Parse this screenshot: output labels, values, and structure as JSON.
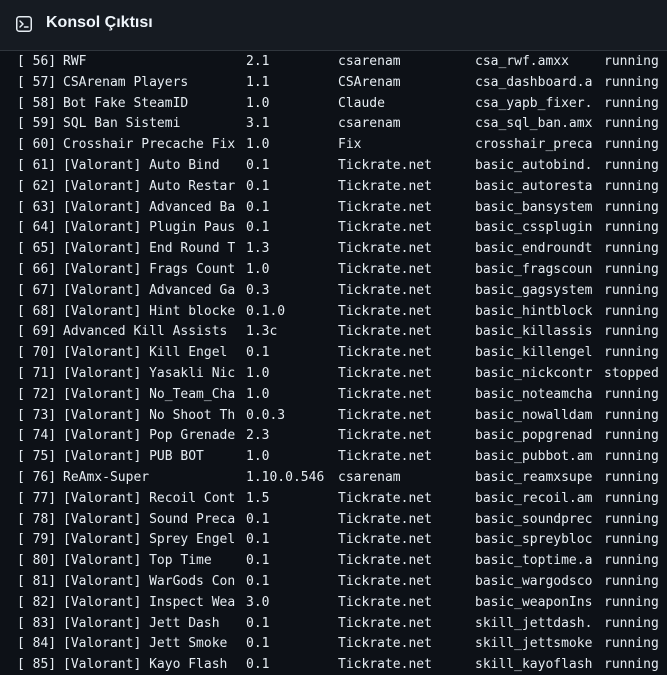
{
  "window": {
    "title": "Konsol Çıktısı",
    "icon": "terminal-icon"
  },
  "rows": [
    {
      "idx": "[ 56]",
      "name": "RWF",
      "version": "2.1",
      "author": "csarenam",
      "file": "csa_rwf.amxx",
      "status": "running"
    },
    {
      "idx": "[ 57]",
      "name": "CSArenam Players",
      "version": "1.1",
      "author": "CSArenam",
      "file": "csa_dashboard.a",
      "status": "running"
    },
    {
      "idx": "[ 58]",
      "name": "Bot Fake SteamID",
      "version": "1.0",
      "author": "Claude",
      "file": "csa_yapb_fixer.",
      "status": "running"
    },
    {
      "idx": "[ 59]",
      "name": "SQL Ban Sistemi",
      "version": "3.1",
      "author": "csarenam",
      "file": "csa_sql_ban.amx",
      "status": "running"
    },
    {
      "idx": "[ 60]",
      "name": "Crosshair Precache Fix",
      "version": "1.0",
      "author": "Fix",
      "file": "crosshair_preca",
      "status": "running"
    },
    {
      "idx": "[ 61]",
      "name": "[Valorant] Auto Bind",
      "version": "0.1",
      "author": "Tickrate.net",
      "file": "basic_autobind.",
      "status": "running"
    },
    {
      "idx": "[ 62]",
      "name": "[Valorant] Auto Restar",
      "version": "0.1",
      "author": "Tickrate.net",
      "file": "basic_autoresta",
      "status": "running"
    },
    {
      "idx": "[ 63]",
      "name": "[Valorant] Advanced Ba",
      "version": "0.1",
      "author": "Tickrate.net",
      "file": "basic_bansystem",
      "status": "running"
    },
    {
      "idx": "[ 64]",
      "name": "[Valorant] Plugin Paus",
      "version": "0.1",
      "author": "Tickrate.net",
      "file": "basic_cssplugin",
      "status": "running"
    },
    {
      "idx": "[ 65]",
      "name": "[Valorant] End Round T",
      "version": "1.3",
      "author": "Tickrate.net",
      "file": "basic_endroundt",
      "status": "running"
    },
    {
      "idx": "[ 66]",
      "name": "[Valorant] Frags Count",
      "version": "1.0",
      "author": "Tickrate.net",
      "file": "basic_fragscoun",
      "status": "running"
    },
    {
      "idx": "[ 67]",
      "name": "[Valorant] Advanced Ga",
      "version": "0.3",
      "author": "Tickrate.net",
      "file": "basic_gagsystem",
      "status": "running"
    },
    {
      "idx": "[ 68]",
      "name": "[Valorant] Hint blocke",
      "version": "0.1.0",
      "author": "Tickrate.net",
      "file": "basic_hintblock",
      "status": "running"
    },
    {
      "idx": "[ 69]",
      "name": "Advanced Kill Assists",
      "version": "1.3c",
      "author": "Tickrate.net",
      "file": "basic_killassis",
      "status": "running"
    },
    {
      "idx": "[ 70]",
      "name": "[Valorant] Kill Engel",
      "version": "0.1",
      "author": "Tickrate.net",
      "file": "basic_killengel",
      "status": "running"
    },
    {
      "idx": "[ 71]",
      "name": "[Valorant] Yasakli Nic",
      "version": "1.0",
      "author": "Tickrate.net",
      "file": "basic_nickcontr",
      "status": "stopped"
    },
    {
      "idx": "[ 72]",
      "name": "[Valorant] No_Team_Cha",
      "version": "1.0",
      "author": "Tickrate.net",
      "file": "basic_noteamcha",
      "status": "running"
    },
    {
      "idx": "[ 73]",
      "name": "[Valorant] No Shoot Th",
      "version": "0.0.3",
      "author": "Tickrate.net",
      "file": "basic_nowalldam",
      "status": "running"
    },
    {
      "idx": "[ 74]",
      "name": "[Valorant] Pop Grenade",
      "version": "2.3",
      "author": "Tickrate.net",
      "file": "basic_popgrenad",
      "status": "running"
    },
    {
      "idx": "[ 75]",
      "name": "[Valorant] PUB BOT",
      "version": "1.0",
      "author": "Tickrate.net",
      "file": "basic_pubbot.am",
      "status": "running"
    },
    {
      "idx": "[ 76]",
      "name": "ReAmx-Super",
      "version": "1.10.0.546",
      "author": "csarenam",
      "file": "basic_reamxsupe",
      "status": "running"
    },
    {
      "idx": "[ 77]",
      "name": "[Valorant] Recoil Cont",
      "version": "1.5",
      "author": "Tickrate.net",
      "file": "basic_recoil.am",
      "status": "running"
    },
    {
      "idx": "[ 78]",
      "name": "[Valorant] Sound Preca",
      "version": "0.1",
      "author": "Tickrate.net",
      "file": "basic_soundprec",
      "status": "running"
    },
    {
      "idx": "[ 79]",
      "name": "[Valorant] Sprey Engel",
      "version": "0.1",
      "author": "Tickrate.net",
      "file": "basic_spreybloc",
      "status": "running"
    },
    {
      "idx": "[ 80]",
      "name": "[Valorant] Top Time",
      "version": "0.1",
      "author": "Tickrate.net",
      "file": "basic_toptime.a",
      "status": "running"
    },
    {
      "idx": "[ 81]",
      "name": "[Valorant] WarGods Con",
      "version": "0.1",
      "author": "Tickrate.net",
      "file": "basic_wargodsco",
      "status": "running"
    },
    {
      "idx": "[ 82]",
      "name": "[Valorant] Inspect Wea",
      "version": "3.0",
      "author": "Tickrate.net",
      "file": "basic_weaponIns",
      "status": "running"
    },
    {
      "idx": "[ 83]",
      "name": "[Valorant] Jett Dash",
      "version": "0.1",
      "author": "Tickrate.net",
      "file": "skill_jettdash.",
      "status": "running"
    },
    {
      "idx": "[ 84]",
      "name": "[Valorant] Jett Smoke",
      "version": "0.1",
      "author": "Tickrate.net",
      "file": "skill_jettsmoke",
      "status": "running"
    },
    {
      "idx": "[ 85]",
      "name": "[Valorant] Kayo Flash",
      "version": "0.1",
      "author": "Tickrate.net",
      "file": "skill_kayoflash",
      "status": "running"
    }
  ]
}
